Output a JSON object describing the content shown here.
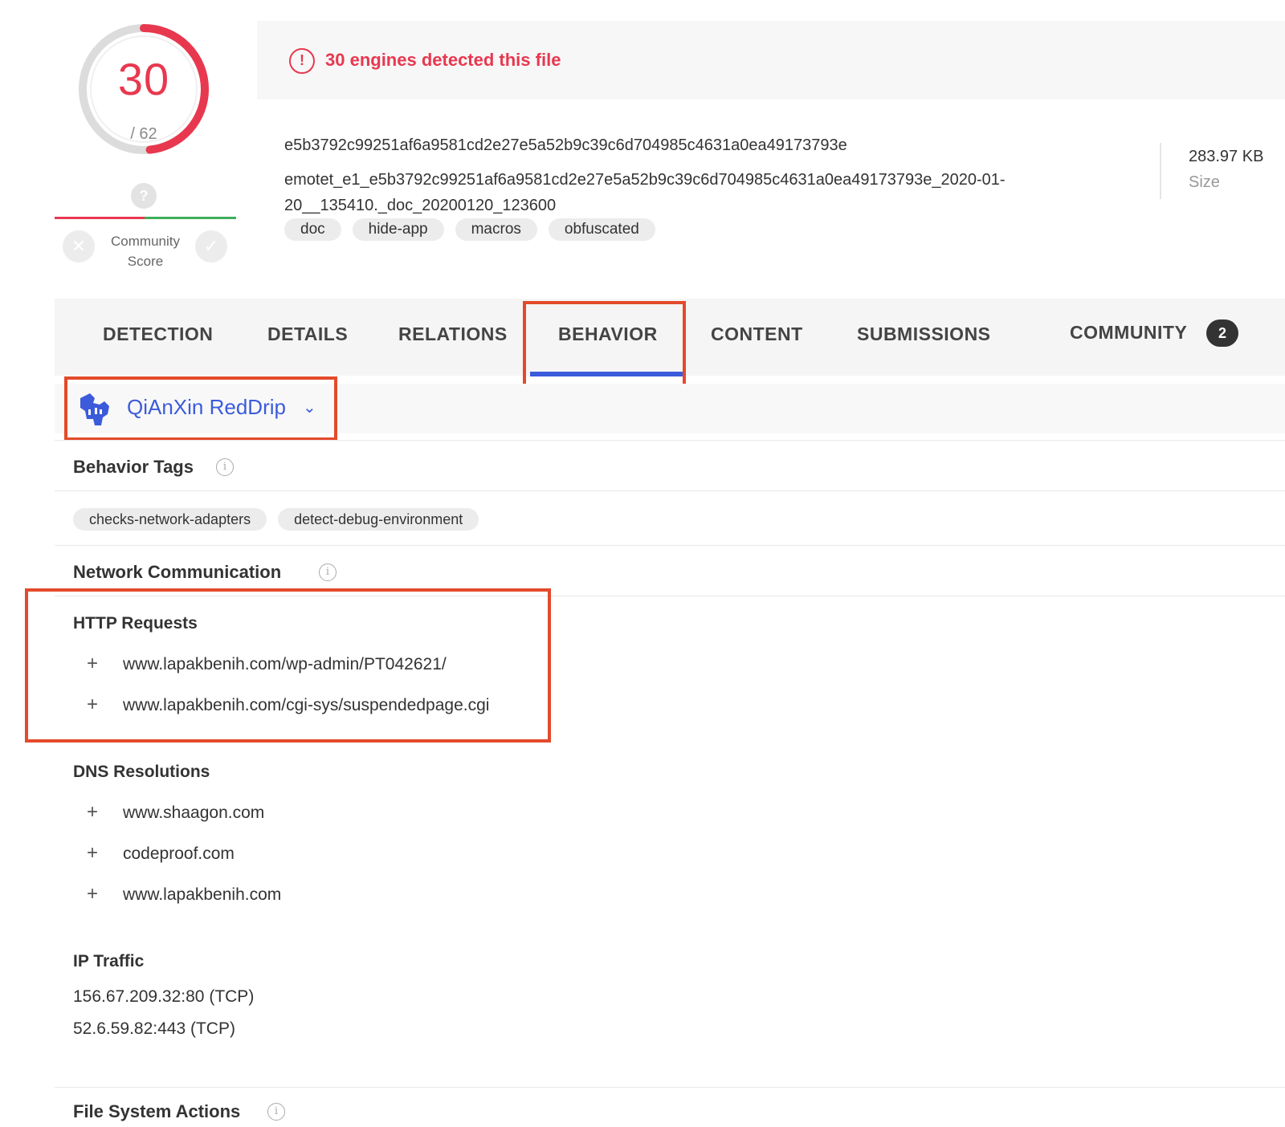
{
  "score": {
    "detected": "30",
    "total": "/ 62"
  },
  "community": {
    "question": "?",
    "label_line1": "Community",
    "label_line2": "Score",
    "downvote": "✕",
    "upvote": "✓"
  },
  "banner": {
    "icon": "!",
    "text": "30 engines detected this file"
  },
  "file": {
    "hash": "e5b3792c99251af6a9581cd2e27e5a52b9c39c6d704985c4631a0ea49173793e",
    "name": "emotet_e1_e5b3792c99251af6a9581cd2e27e5a52b9c39c6d704985c4631a0ea49173793e_2020-01-20__135410._doc_20200120_123600",
    "tags": [
      "doc",
      "hide-app",
      "macros",
      "obfuscated"
    ],
    "size_value": "283.97 KB",
    "size_label": "Size"
  },
  "tabs": [
    {
      "label": "DETECTION"
    },
    {
      "label": "DETAILS"
    },
    {
      "label": "RELATIONS"
    },
    {
      "label": "BEHAVIOR"
    },
    {
      "label": "CONTENT"
    },
    {
      "label": "SUBMISSIONS"
    },
    {
      "label": "COMMUNITY"
    }
  ],
  "active_tab": "BEHAVIOR",
  "community_badge": "2",
  "sandbox": {
    "name": "QiAnXin RedDrip",
    "chevron": "⌄"
  },
  "behavior_tags": {
    "title": "Behavior Tags",
    "items": [
      "checks-network-adapters",
      "detect-debug-environment"
    ]
  },
  "network": {
    "title": "Network Communication",
    "http": {
      "title": "HTTP Requests",
      "items": [
        "www.lapakbenih.com/wp-admin/PT042621/",
        "www.lapakbenih.com/cgi-sys/suspendedpage.cgi"
      ]
    },
    "dns": {
      "title": "DNS Resolutions",
      "items": [
        "www.shaagon.com",
        "codeproof.com",
        "www.lapakbenih.com"
      ]
    },
    "ip": {
      "title": "IP Traffic",
      "items": [
        "156.67.209.32:80 (TCP)",
        "52.6.59.82:443 (TCP)"
      ]
    }
  },
  "file_system": {
    "title": "File System Actions"
  },
  "info_glyph": "i",
  "plus_glyph": "+",
  "colors": {
    "detection_red": "#e8384f",
    "accent_blue": "#3b5bdb",
    "highlight_orange": "#e34a2b",
    "community_green": "#3fae5a"
  }
}
